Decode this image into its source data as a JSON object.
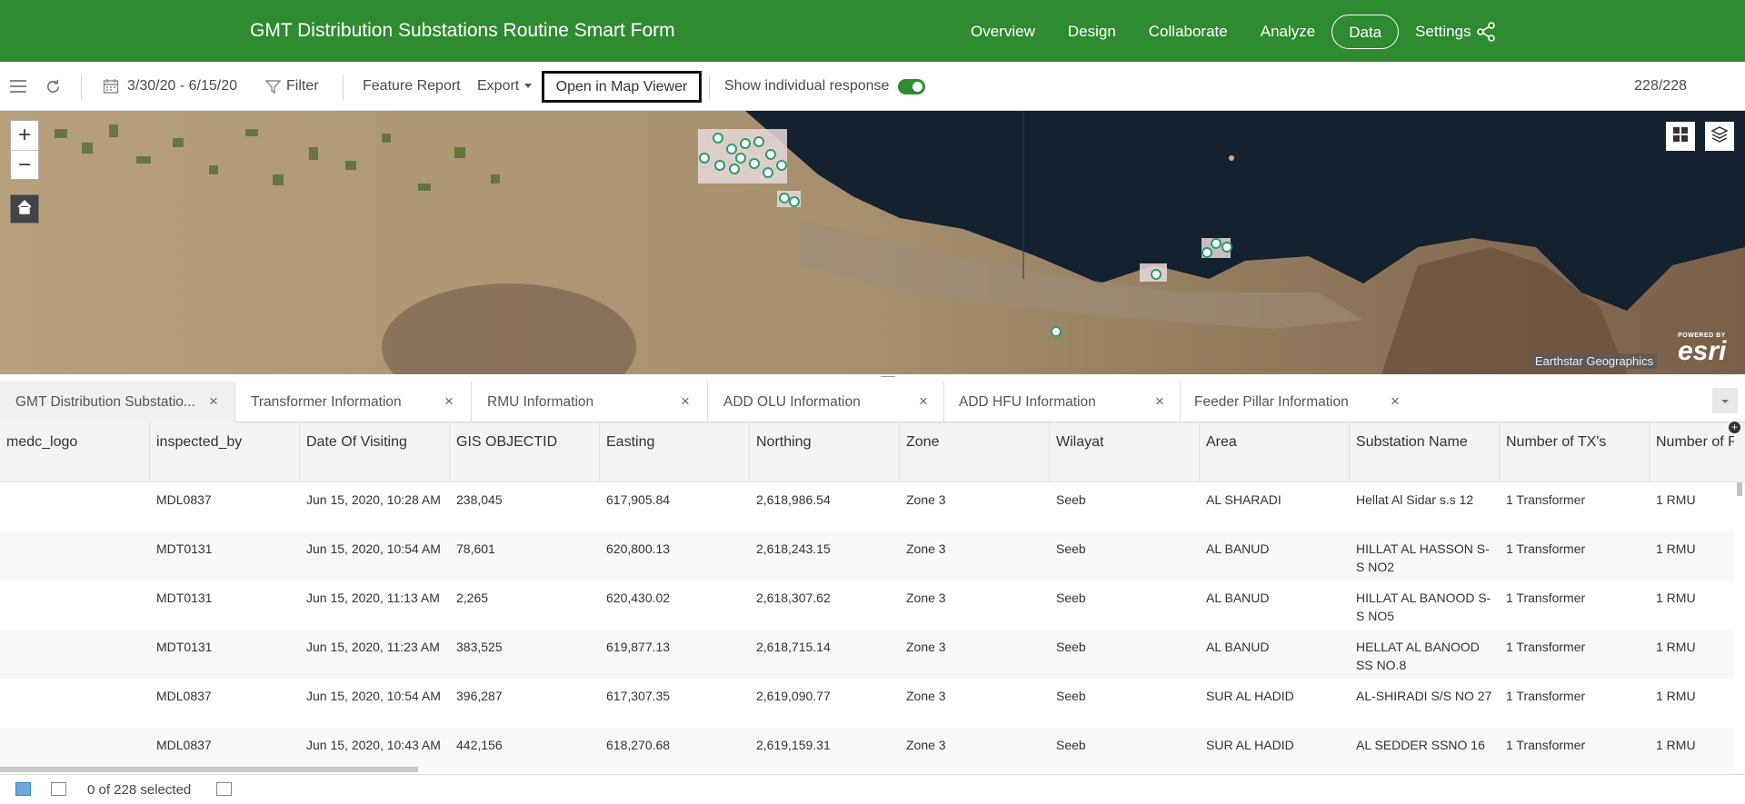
{
  "header": {
    "title": "GMT Distribution Substations Routine Smart Form",
    "nav": [
      {
        "label": "Overview",
        "active": false
      },
      {
        "label": "Design",
        "active": false
      },
      {
        "label": "Collaborate",
        "active": false
      },
      {
        "label": "Analyze",
        "active": false
      },
      {
        "label": "Data",
        "active": true
      },
      {
        "label": "Settings",
        "active": false
      }
    ],
    "bg_color": "#2e8b2f"
  },
  "toolbar": {
    "date_range": "3/30/20 - 6/15/20",
    "filter_label": "Filter",
    "feature_report_label": "Feature Report",
    "export_label": "Export",
    "open_map_label": "Open in Map Viewer",
    "show_individual_label": "Show individual response",
    "show_individual_on": true,
    "record_count": "228/228"
  },
  "map": {
    "attribution": "Earthstar Geographics",
    "powered_by": "POWERED BY",
    "esri_logo": "esri"
  },
  "tabs": [
    {
      "label": "GMT Distribution Substatio...",
      "active": true
    },
    {
      "label": "Transformer Information",
      "active": false
    },
    {
      "label": "RMU Information",
      "active": false
    },
    {
      "label": "ADD OLU Information",
      "active": false
    },
    {
      "label": "ADD HFU Information",
      "active": false
    },
    {
      "label": "Feeder Pillar Information",
      "active": false
    }
  ],
  "table": {
    "columns": [
      "medc_logo",
      "inspected_by",
      "Date Of Visiting",
      "GIS OBJECTID",
      "Easting",
      "Northing",
      "Zone",
      "Wilayat",
      "Area",
      "Substation Name",
      "Number of TX's",
      "Number of R"
    ],
    "rows": [
      [
        "",
        "MDL0837",
        "Jun 15, 2020, 10:28 AM",
        "238,045",
        "617,905.84",
        "2,618,986.54",
        "Zone 3",
        "Seeb",
        "AL SHARADI",
        "Hellat Al Sidar s.s 12",
        "1 Transformer",
        "1 RMU"
      ],
      [
        "",
        "MDT0131",
        "Jun 15, 2020, 10:54 AM",
        "78,601",
        "620,800.13",
        "2,618,243.15",
        "Zone 3",
        "Seeb",
        "AL BANUD",
        "HILLAT AL HASSON S-S NO2",
        "1 Transformer",
        "1 RMU"
      ],
      [
        "",
        "MDT0131",
        "Jun 15, 2020, 11:13 AM",
        "2,265",
        "620,430.02",
        "2,618,307.62",
        "Zone 3",
        "Seeb",
        "AL BANUD",
        "HILLAT AL BANOOD S-S NO5",
        "1 Transformer",
        "1 RMU"
      ],
      [
        "",
        "MDT0131",
        "Jun 15, 2020, 11:23 AM",
        "383,525",
        "619,877.13",
        "2,618,715.14",
        "Zone 3",
        "Seeb",
        "AL BANUD",
        "HELLAT AL BANOOD SS NO.8",
        "1 Transformer",
        "1 RMU"
      ],
      [
        "",
        "MDL0837",
        "Jun 15, 2020, 10:54 AM",
        "396,287",
        "617,307.35",
        "2,619,090.77",
        "Zone 3",
        "Seeb",
        "SUR AL HADID",
        "AL-SHIRADI S/S NO 27",
        "1 Transformer",
        "1 RMU"
      ],
      [
        "",
        "MDL0837",
        "Jun 15, 2020, 10:43 AM",
        "442,156",
        "618,270.68",
        "2,619,159.31",
        "Zone 3",
        "Seeb",
        "SUR AL HADID",
        "AL SEDDER SSNO 16",
        "1 Transformer",
        "1 RMU"
      ]
    ]
  },
  "footer": {
    "selection_text": "0 of 228 selected"
  }
}
